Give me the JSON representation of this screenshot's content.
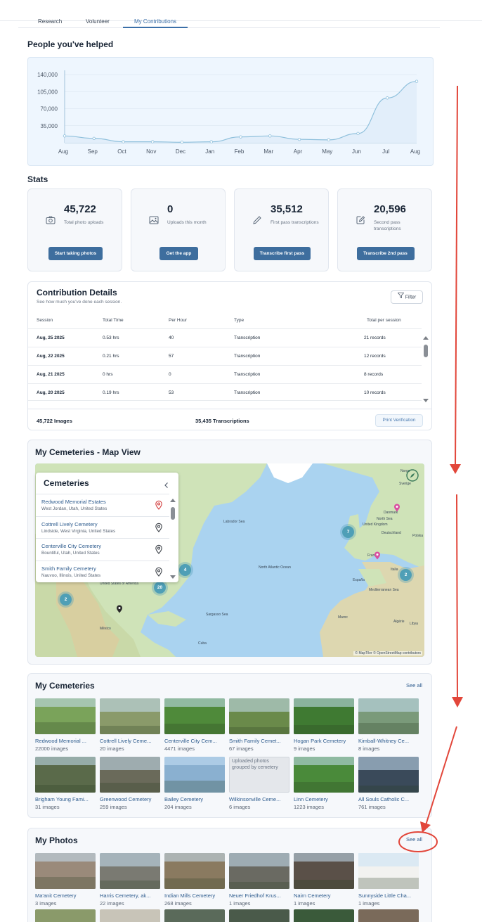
{
  "tabs": [
    "Research",
    "Volunteer",
    "My Contributions"
  ],
  "people_title": "People you've helped",
  "chart_data": {
    "type": "area",
    "categories": [
      "Aug",
      "Sep",
      "Oct",
      "Nov",
      "Dec",
      "Jan",
      "Feb",
      "Mar",
      "Apr",
      "May",
      "Jun",
      "Jul",
      "Aug"
    ],
    "values": [
      14000,
      9000,
      2000,
      2000,
      1000,
      2000,
      12000,
      14000,
      7000,
      6000,
      19000,
      92000,
      126000
    ],
    "yticks": [
      "140,000",
      "105,000",
      "70,000",
      "35,000"
    ],
    "ylim": [
      0,
      140000
    ],
    "grid": true,
    "color": "#8fc0dc"
  },
  "stats_title": "Stats",
  "stats": [
    {
      "icon": "camera-icon",
      "value": "45,722",
      "label": "Total photo uploads",
      "button": "Start taking photos"
    },
    {
      "icon": "image-icon",
      "value": "0",
      "label": "Uploads this month",
      "button": "Get the app"
    },
    {
      "icon": "pencil-icon",
      "value": "35,512",
      "label": "First pass transcriptions",
      "button": "Transcribe first pass"
    },
    {
      "icon": "edit-icon",
      "value": "20,596",
      "label": "Second pass transcriptions",
      "button": "Transcribe 2nd pass"
    }
  ],
  "details": {
    "title": "Contribution Details",
    "subtitle": "See how much you've done each session.",
    "filter": "Filter",
    "headers": [
      "Session",
      "Total Time",
      "Per Hour",
      "Type",
      "Total per session"
    ],
    "rows": [
      [
        "Aug, 25 2025",
        "0.53 hrs",
        "40",
        "Transcription",
        "21 records"
      ],
      [
        "Aug, 22 2025",
        "0.21 hrs",
        "57",
        "Transcription",
        "12 records"
      ],
      [
        "Aug, 21 2025",
        "0 hrs",
        "0",
        "Transcription",
        "8 records"
      ],
      [
        "Aug, 20 2025",
        "0.19 hrs",
        "53",
        "Transcription",
        "10 records"
      ]
    ],
    "footer_images": "45,722 Images",
    "footer_trans": "35,435 Transcriptions",
    "print": "Print Verification"
  },
  "mapview": {
    "title": "My Cemeteries - Map View",
    "panel_title": "Cemeteries",
    "items": [
      {
        "name": "Redwood Memorial Estates",
        "loc": "West Jordan, Utah, United States"
      },
      {
        "name": "Cottrell Lively Cemetery",
        "loc": "Lindside, West Virginia, United States"
      },
      {
        "name": "Centerville City Cemetery",
        "loc": "Bountiful, Utah, United States"
      },
      {
        "name": "Smith Family Cemetery",
        "loc": "Nauvoo, Illinois, United States"
      }
    ],
    "clusters": [
      "4",
      "20",
      "2",
      "7",
      "2"
    ],
    "labels": [
      "Labrador Sea",
      "North Atlantic Ocean",
      "Sargasso Sea",
      "United States of America",
      "México",
      "United Kingdom",
      "France",
      "España",
      "Deutschland",
      "Polska",
      "Mediterranean Sea",
      "Algérie",
      "Libya",
      "Maroc",
      "Norge",
      "Sverige",
      "Danmark",
      "North Sea",
      "Cuba",
      "Italia"
    ],
    "attribution": "© MapTiler © OpenStreetMap contributors"
  },
  "cemeteries": {
    "title": "My Cemeteries",
    "see_all": "See all",
    "items": [
      {
        "name": "Redwood Memorial ...",
        "count": "22000 images",
        "color": "#7aa35a"
      },
      {
        "name": "Cottrell Lively Ceme...",
        "count": "20 images",
        "color": "#8a9a6a"
      },
      {
        "name": "Centerville City Cem...",
        "count": "4471 images",
        "color": "#4f8a3a"
      },
      {
        "name": "Smith Family Cemet...",
        "count": "67 images",
        "color": "#6a8a4a"
      },
      {
        "name": "Hogan Park Cemetery",
        "count": "9 images",
        "color": "#3f7a32"
      },
      {
        "name": "Kimball-Whitney Ce...",
        "count": "8 images",
        "color": "#7a9a7a"
      },
      {
        "name": "Brigham Young Fami...",
        "count": "31 images",
        "color": "#5a6a4a"
      },
      {
        "name": "Greenwood Cemetery",
        "count": "259 images",
        "color": "#6a6a5a"
      },
      {
        "name": "Bailey Cemetery",
        "count": "204 images",
        "color": "#8ab0d0"
      },
      {
        "name": "Wilkinsonville Ceme...",
        "count": "6 images",
        "color": "#e4e7eb"
      },
      {
        "name": "Linn Cemetery",
        "count": "1223 images",
        "color": "#4a8a3a"
      },
      {
        "name": "All Souls Catholic C...",
        "count": "761 images",
        "color": "#3a4a5a"
      }
    ],
    "placeholder_alt": "Uploaded photos grouped by cemetery"
  },
  "photos": {
    "title": "My Photos",
    "see_all": "See all",
    "items": [
      {
        "name": "Ma'anit Cemetery",
        "count": "3 images",
        "color": "#9a8a7a"
      },
      {
        "name": "Harris Cemetery, ak...",
        "count": "22 images",
        "color": "#7a7a72"
      },
      {
        "name": "Indian Mills Cemetery",
        "count": "268 images",
        "color": "#8a7a60"
      },
      {
        "name": "Neuer Friedhof Krus...",
        "count": "1 images",
        "color": "#6a6a62"
      },
      {
        "name": "Nairn Cemetery",
        "count": "1 images",
        "color": "#5a5048"
      },
      {
        "name": "Sunnyside Little Cha...",
        "count": "1 images",
        "color": "#f2f2f0"
      }
    ]
  }
}
